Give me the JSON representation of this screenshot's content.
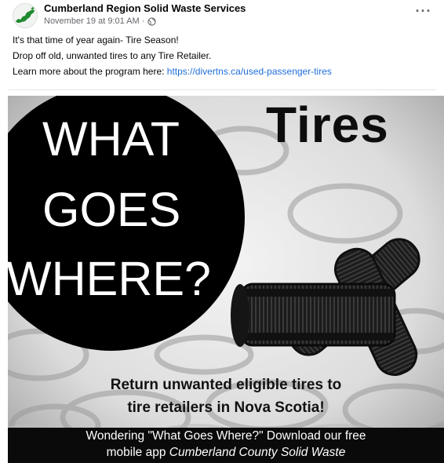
{
  "post": {
    "author": "Cumberland Region Solid Waste Services",
    "timestamp": "November 19 at 9:01 AM ·",
    "privacy_icon": "globe-icon",
    "more_icon": "ellipsis-icon",
    "more_label": "···",
    "lines": [
      "It's that time of year again- Tire Season!",
      "Drop off old, unwanted tires to any Tire Retailer."
    ],
    "learn_more_prefix": "Learn more about the program here: ",
    "link": "https://divertns.ca/used-passenger-tires"
  },
  "image": {
    "headline": "Tires",
    "circle_lines": [
      "WHAT",
      "GOES",
      "WHERE?"
    ],
    "return_lines": [
      "Return unwanted eligible tires to",
      "tire retailers  in Nova Scotia!"
    ],
    "banner_line1": "Wondering \"What Goes Where?\" Download our free",
    "banner_prefix": "mobile app ",
    "banner_app": "Cumberland County Solid Waste",
    "colors": {
      "circle": "#000000",
      "banner": "#0a0a0a",
      "link": "#216fdb"
    }
  }
}
